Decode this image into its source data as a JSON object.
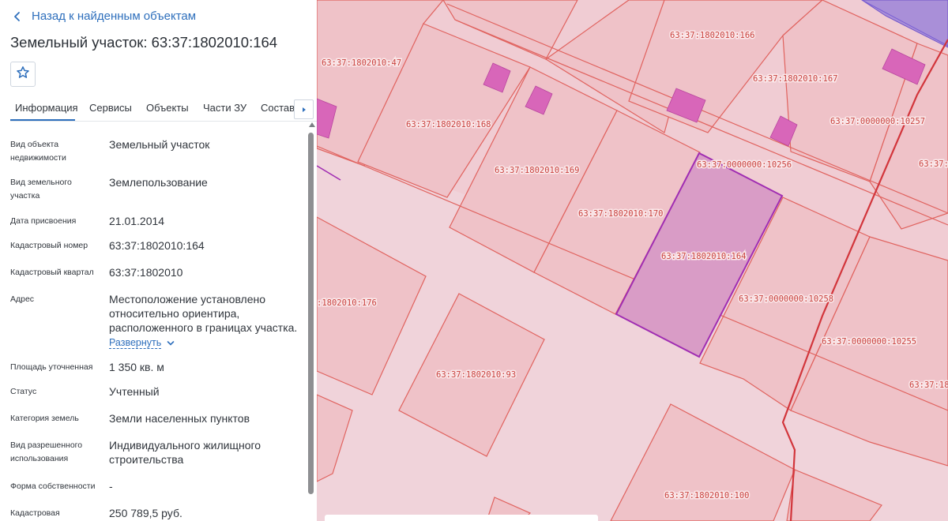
{
  "panel": {
    "back_label": "Назад к найденным объектам",
    "title": "Земельный участок: 63:37:1802010:164",
    "tabs": [
      {
        "label": "Информация"
      },
      {
        "label": "Сервисы"
      },
      {
        "label": "Объекты"
      },
      {
        "label": "Части ЗУ"
      },
      {
        "label": "Состав"
      }
    ],
    "active_tab": "Информация",
    "properties": [
      {
        "label": "Вид объекта недвижимости",
        "value": "Земельный участок"
      },
      {
        "label": "Вид земельного участка",
        "value": "Землепользование"
      },
      {
        "label": "Дата присвоения",
        "value": "21.01.2014"
      },
      {
        "label": "Кадастровый номер",
        "value": "63:37:1802010:164"
      },
      {
        "label": "Кадастровый квартал",
        "value": "63:37:1802010"
      },
      {
        "label": "Адрес",
        "value": "Местоположение установлено относительно ориентира, расположенного в границах участка."
      },
      {
        "label": "Площадь уточненная",
        "value": "1 350 кв. м"
      },
      {
        "label": "Статус",
        "value": "Учтенный"
      },
      {
        "label": "Категория земель",
        "value": "Земли населенных пунктов"
      },
      {
        "label": "Вид разрешенного использования",
        "value": "Индивидуального жилищного строительства"
      },
      {
        "label": "Форма собственности",
        "value": "-"
      },
      {
        "label": "Кадастровая",
        "value": "250 789,5 руб."
      }
    ],
    "expand_label": "Развернуть"
  },
  "map": {
    "colors": {
      "background": "#f0ccd3",
      "parcel_fill": "#efc2c8",
      "parcel_stroke": "#e0625e",
      "building_fill": "#d866b9",
      "selected_fill": "#d99cc6",
      "selected_stroke": "#a02db2",
      "boundary_line": "#d2353b",
      "label_color": "#c9423e"
    },
    "labels": [
      {
        "id": "p47",
        "text": "63:37:1802010:47"
      },
      {
        "id": "p168",
        "text": "63:37:1802010:168"
      },
      {
        "id": "p169",
        "text": "63:37:1802010:169"
      },
      {
        "id": "p170",
        "text": "63:37:1802010:170"
      },
      {
        "id": "p166",
        "text": "63:37:1802010:166"
      },
      {
        "id": "p167",
        "text": "63:37:1802010:167"
      },
      {
        "id": "p10257",
        "text": "63:37:0000000:10257"
      },
      {
        "id": "p10256",
        "text": "63:37:0000000:10256"
      },
      {
        "id": "p164",
        "text": "63:37:1802010:164"
      },
      {
        "id": "p10258",
        "text": "63:37:0000000:10258"
      },
      {
        "id": "p10255",
        "text": "63:37:0000000:10255"
      },
      {
        "id": "p176",
        "text": ":1802010:176"
      },
      {
        "id": "p93",
        "text": "63:37:1802010:93"
      },
      {
        "id": "p100",
        "text": "63:37:1802010:100"
      },
      {
        "id": "p1",
        "text": "63:37:1"
      },
      {
        "id": "p180",
        "text": "63:37:180"
      }
    ]
  }
}
